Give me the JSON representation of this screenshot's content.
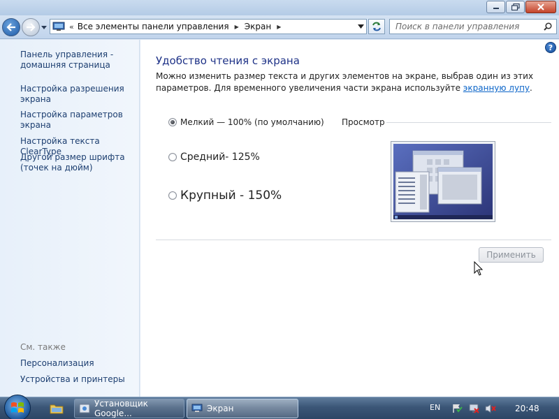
{
  "window": {
    "caption_buttons": [
      "minimize",
      "maximize",
      "close"
    ]
  },
  "address": {
    "overflow": "«",
    "crumbs": [
      "Все элементы панели управления",
      "Экран"
    ]
  },
  "search": {
    "placeholder": "Поиск в панели управления"
  },
  "sidebar": {
    "links": [
      {
        "label": "Панель управления - домашняя страница"
      },
      {
        "label": "Настройка разрешения экрана"
      },
      {
        "label": "Настройка параметров экрана"
      },
      {
        "label": "Настройка текста ClearType"
      },
      {
        "label": "Другой размер шрифта (точек на дюйм)"
      }
    ],
    "see_also_label": "См. также",
    "see_also": [
      {
        "label": "Персонализация"
      },
      {
        "label": "Устройства и принтеры"
      }
    ]
  },
  "main": {
    "heading": "Удобство чтения с экрана",
    "description_text": "Можно изменить размер текста и других элементов на экране, выбрав один из этих параметров. Для временного увеличения части экрана используйте",
    "description_link": "экранную лупу",
    "description_end": ".",
    "options": [
      {
        "label": "Мелкий — 100% (по умолчанию)",
        "checked": true
      },
      {
        "label": "Средний- 125%",
        "checked": false
      },
      {
        "label": "Крупный - 150%",
        "checked": false
      }
    ],
    "preview_label": "Просмотр",
    "apply_label": "Применить",
    "help": "?"
  },
  "taskbar": {
    "items": [
      {
        "label": "Установщик Google..."
      },
      {
        "label": "Экран"
      }
    ],
    "lang": "EN",
    "time": "20:48"
  },
  "colors": {
    "heading": "#1e3287",
    "link": "#0a64c8",
    "sidebar_link": "#1c3e70"
  }
}
